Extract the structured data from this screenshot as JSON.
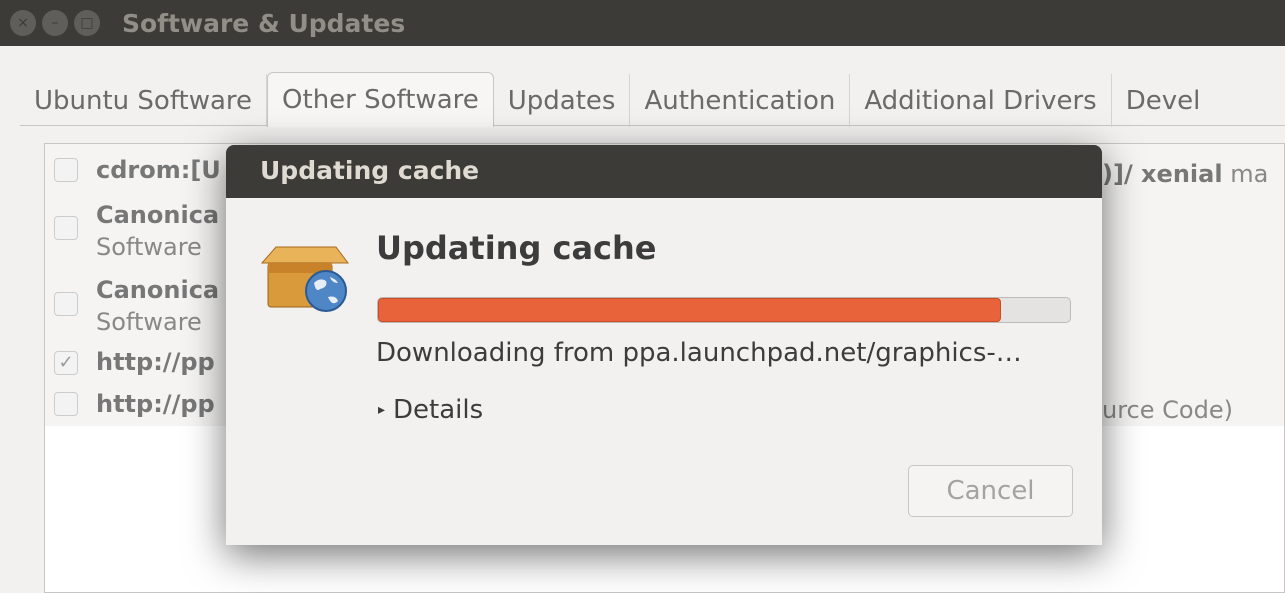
{
  "window": {
    "title": "Software & Updates",
    "controls": [
      "close",
      "minimize",
      "maximize"
    ]
  },
  "tabs": [
    "Ubuntu Software",
    "Other Software",
    "Updates",
    "Authentication",
    "Additional Drivers",
    "Devel"
  ],
  "active_tab": "Other Software",
  "sources": [
    {
      "checked": false,
      "title": "cdrom:[U",
      "title_tail": ")]/ xenial",
      "tail_normal": "ma",
      "subtitle": ""
    },
    {
      "checked": false,
      "title": "Canonica",
      "subtitle": "Software"
    },
    {
      "checked": false,
      "title": "Canonica",
      "subtitle": "Software"
    },
    {
      "checked": true,
      "title": "http://pp",
      "subtitle": ""
    },
    {
      "checked": false,
      "title": "http://pp",
      "tail_normal": "urce Code)",
      "subtitle": ""
    }
  ],
  "dialog": {
    "title": "Updating cache",
    "heading": "Updating cache",
    "progress": 0.9,
    "status": "Downloading from ppa.launchpad.net/graphics-…",
    "details_label": "Details",
    "cancel_label": "Cancel",
    "icon": "package-globe-icon",
    "accent": "#e8623a"
  }
}
